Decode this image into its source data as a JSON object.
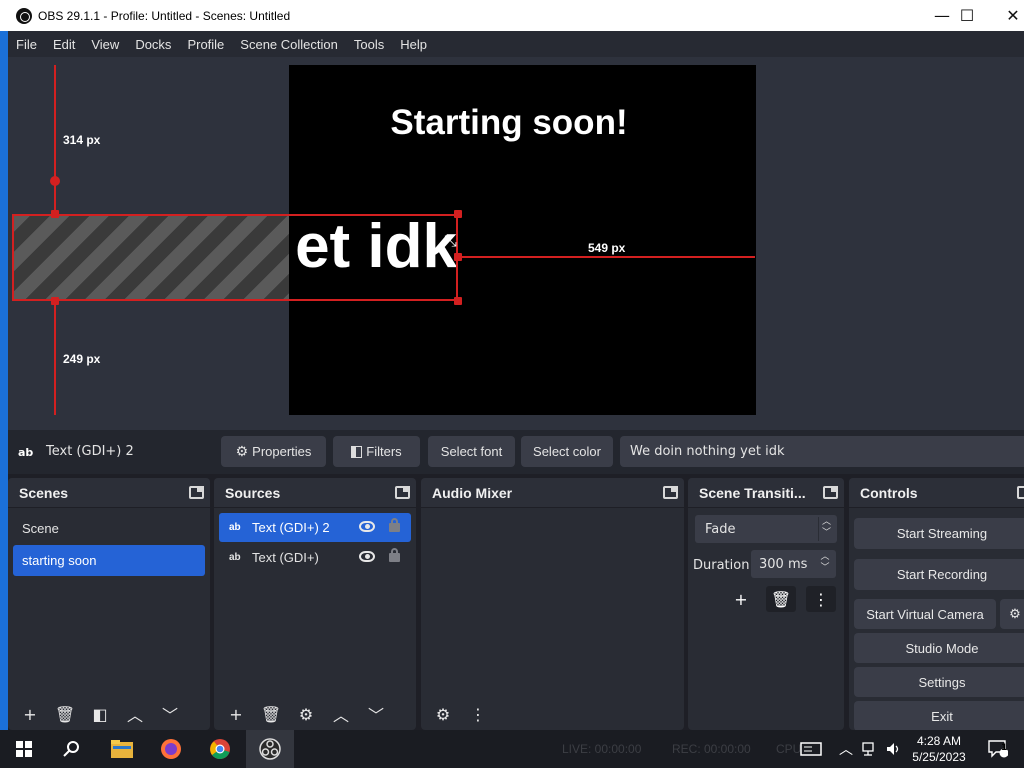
{
  "window": {
    "title": "OBS 29.1.1 - Profile: Untitled - Scenes: Untitled",
    "minimize": "—",
    "maximize": "☐",
    "close": "✕"
  },
  "menu": [
    "File",
    "Edit",
    "View",
    "Docks",
    "Profile",
    "Scene Collection",
    "Tools",
    "Help"
  ],
  "preview": {
    "canvas_title": "Starting soon!",
    "overflow_text": "et idk",
    "dim_top": "314 px",
    "dim_bottom": "249 px",
    "dim_right": "549 px"
  },
  "source_toolbar": {
    "icon": "ab",
    "source_name": "Text (GDI+) 2",
    "properties": "Properties",
    "filters": "Filters",
    "select_font": "Select font",
    "select_color": "Select color",
    "text_value": "We doin nothing yet idk"
  },
  "scenes": {
    "title": "Scenes",
    "items": [
      {
        "label": "Scene",
        "selected": false
      },
      {
        "label": "starting soon",
        "selected": true
      }
    ]
  },
  "sources": {
    "title": "Sources",
    "items": [
      {
        "icon": "ab",
        "label": "Text (GDI+) 2",
        "selected": true
      },
      {
        "icon": "ab",
        "label": "Text (GDI+)",
        "selected": false
      }
    ]
  },
  "audio_mixer": {
    "title": "Audio Mixer"
  },
  "transitions": {
    "title": "Scene Transiti...",
    "selected": "Fade",
    "duration_label": "Duration",
    "duration_value": "300 ms"
  },
  "controls": {
    "title": "Controls",
    "start_streaming": "Start Streaming",
    "start_recording": "Start Recording",
    "start_virtual_camera": "Start Virtual Camera",
    "studio_mode": "Studio Mode",
    "settings": "Settings",
    "exit": "Exit"
  },
  "taskbar": {
    "live": "LIVE: 00:00:00",
    "rec": "REC: 00:00:00",
    "cpu": "CPU",
    "time": "4:28 AM",
    "date": "5/25/2023",
    "notif_count": "1"
  },
  "colors": {
    "accent": "#2563d6",
    "selection_red": "#d32020",
    "panel": "#292c34",
    "button": "#3a3d48"
  }
}
